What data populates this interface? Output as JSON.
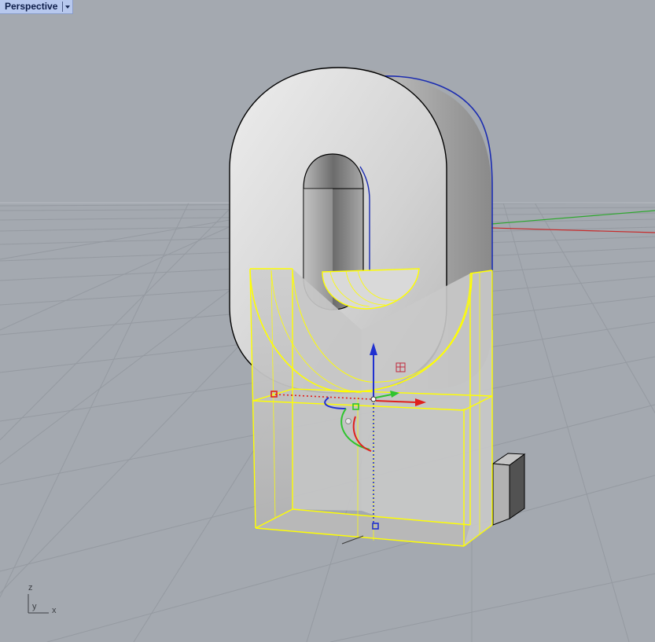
{
  "viewport": {
    "title": "Perspective",
    "view_type": "perspective",
    "menu_icon": "dropdown-arrow-icon"
  },
  "axis_indicator": {
    "z_label": "z",
    "y_label": "y",
    "x_label": "x"
  },
  "colors": {
    "background": "#a4a9b0",
    "grid": "#8f949b",
    "selection": "#ffff00",
    "object_fill": "#d9d9d9",
    "x_axis": "#e0201c",
    "y_axis": "#2ec42e",
    "z_axis": "#2030d0",
    "tab_background": "#b7c8ee"
  },
  "gumball": {
    "visible": true,
    "arrows": [
      "x-axis-arrow",
      "y-axis-arrow",
      "z-axis-arrow"
    ]
  },
  "scene_objects": [
    {
      "name": "extruded-zero-solid",
      "selected": false
    },
    {
      "name": "cutter-box-solid",
      "selected": true
    },
    {
      "name": "small-block-solid",
      "selected": false
    }
  ]
}
